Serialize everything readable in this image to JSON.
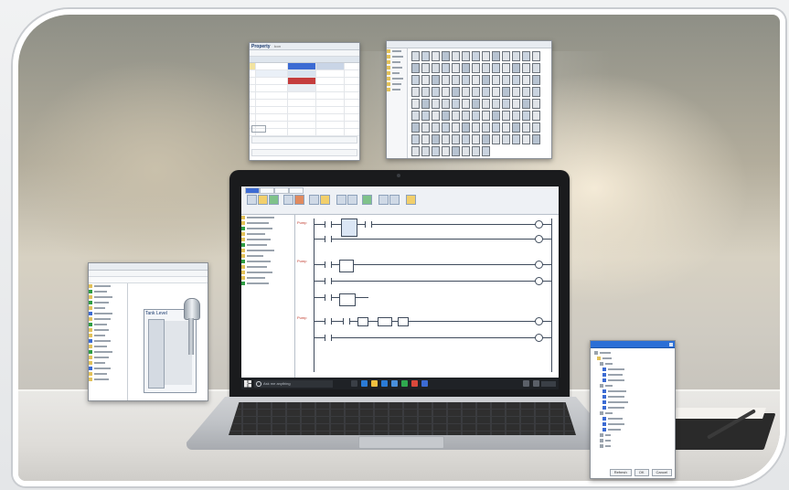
{
  "scene": {
    "description_colors": {
      "wall": "#b3ad9c",
      "desk": "#e9e8e5",
      "frame": "#ffffff"
    }
  },
  "property_window": {
    "title": "Property",
    "tab": "Icon",
    "rows": [
      "",
      "",
      "",
      "",
      "",
      "",
      "",
      "",
      "",
      "",
      "",
      ""
    ]
  },
  "tank_window": {
    "title": "Tank Level"
  },
  "tree_dialog": {
    "buttons": [
      "Refresh",
      "OK",
      "Cancel"
    ]
  },
  "laptop": {
    "taskbar": {
      "search_placeholder": "Ask me anything"
    },
    "ladder": {
      "rung_labels": [
        "Pump",
        "Pump",
        "Pump"
      ]
    }
  },
  "icons": {
    "start": "windows-start-icon",
    "search": "search-icon"
  }
}
